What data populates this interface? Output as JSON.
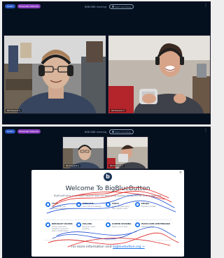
{
  "header": {
    "room_title": "BBB.BBB meeting",
    "chip_audio": "Audio",
    "chip_presenter": "Presenter features",
    "recording_label": "Start recording",
    "menu_icon": "more-vertical-icon"
  },
  "participants": [
    {
      "name": "Participant 1"
    },
    {
      "name": "Participant 2"
    }
  ],
  "welcome_modal": {
    "logo_letter": "b",
    "title": "Welcome To BigBlueButton",
    "tagline": "BigBlueButton is an open source web conferencing system designed for online learning.",
    "features": [
      {
        "title": "CHAT",
        "desc": "Send public and private messages",
        "icon": "chat-icon"
      },
      {
        "title": "WEBCAMS",
        "desc": "Hold virtual meetings",
        "icon": "webcam-icon"
      },
      {
        "title": "AUDIO",
        "desc": "Communicate using high quality audio",
        "icon": "audio-icon"
      },
      {
        "title": "EMOJIS",
        "desc": "Express yourself",
        "icon": "emoji-icon"
      },
      {
        "title": "BREAKOUT ROOMS",
        "desc": "Group users into breakout rooms for team collaboration",
        "icon": "breakout-icon"
      },
      {
        "title": "POLLING",
        "desc": "Poll your users anytime",
        "icon": "poll-icon"
      },
      {
        "title": "SCREEN SHARING",
        "desc": "Share your screen",
        "icon": "screen-share-icon"
      },
      {
        "title": "MULTI-USER WHITEBOARD",
        "desc": "Draw together",
        "icon": "whiteboard-icon"
      }
    ],
    "more_info_text": "For more information visit",
    "more_info_link": "bigbluebutton.org →",
    "close_label": "×"
  },
  "colors": {
    "background": "#05101f",
    "chip_blue": "#2b59c3",
    "chip_purple": "#8a3ec0",
    "accent": "#1a73e8",
    "scribble_red": "#e0211d",
    "scribble_blue": "#1f4fd1"
  }
}
